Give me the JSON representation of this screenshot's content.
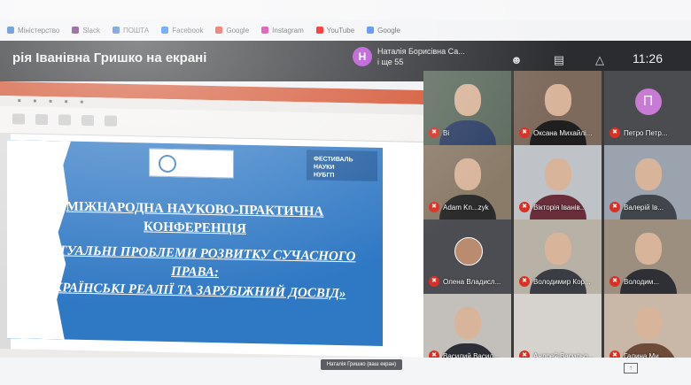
{
  "bookmarks": [
    {
      "label": "Міністерство",
      "color": "#3a7bd5"
    },
    {
      "label": "Slack",
      "color": "#611f69"
    },
    {
      "label": "ПОШТА",
      "color": "#2f6fd0"
    },
    {
      "label": "Facebook",
      "color": "#1877f2"
    },
    {
      "label": "Google",
      "color": "#ea4335"
    },
    {
      "label": "Instagram",
      "color": "#d6249f"
    },
    {
      "label": "YouTube",
      "color": "#ff0000"
    },
    {
      "label": "Google",
      "color": "#4285f4"
    }
  ],
  "meet": {
    "presenter_title": "рія Іванівна Гришко на екрані",
    "participants_initial": "Н",
    "participants_name": "Наталія Борисівна Са...",
    "participants_more": "і ще 55",
    "clock": "11:26"
  },
  "slide": {
    "logo_text": "",
    "badge_line1": "ФЕСТИВАЛЬ НАУКИ",
    "badge_line2": "НУБГП",
    "line1": "МІЖНАРОДНА НАУКОВО-ПРАКТИЧНА",
    "line2": "КОНФЕРЕНЦІЯ",
    "line3": "«АКТУАЛЬНІ ПРОБЛЕМИ РОЗВИТКУ СУЧАСНОГО",
    "line4": "ПРАВА:",
    "line5": "УКРАЇНСЬКІ РЕАЛІЇ ТА ЗАРУБІЖНИЙ ДОСВІД»"
  },
  "tiles": [
    {
      "name": "Ві",
      "bg": "#5d6b5e",
      "face": true,
      "shirt": "#2c3e66"
    },
    {
      "name": "Оксана Михайлі...",
      "bg": "#7d6a5c",
      "face": true,
      "shirt": "#1f1f1f"
    },
    {
      "name": "Петро Петр...",
      "bg": "#4a4c50",
      "letter": "П"
    },
    {
      "name": "Adam Kn...zyk",
      "bg": "#8a7a68",
      "face": true,
      "shirt": "#2b2b2b"
    },
    {
      "name": "Вікторія Іванів...",
      "bg": "#bfc3c7",
      "face": true,
      "shirt": "#6a2e3a"
    },
    {
      "name": "Валерій Ів...",
      "bg": "#9aa3ae",
      "face": true,
      "shirt": "#41464d"
    },
    {
      "name": "Олена Владисл...",
      "bg": "#4b4d52",
      "photo": true
    },
    {
      "name": "Володимир Кор...",
      "bg": "#b8b2a6",
      "face": true,
      "shirt": "#3a3d44"
    },
    {
      "name": "Володим...",
      "bg": "#9c8f80",
      "face": true,
      "shirt": "#2e3035"
    },
    {
      "name": "Василий Васил...",
      "bg": "#c3c0bb",
      "face": true,
      "shirt": "#2d2f36"
    },
    {
      "name": "Андрей Васильо...",
      "bg": "#d6d3cf",
      "face": false
    },
    {
      "name": "Галина Ми...",
      "bg": "#c9b8a8",
      "face": true,
      "shirt": "#6d4a3a"
    }
  ],
  "bottom": {
    "caption": "Наталія Гришко (ваш екран)"
  }
}
